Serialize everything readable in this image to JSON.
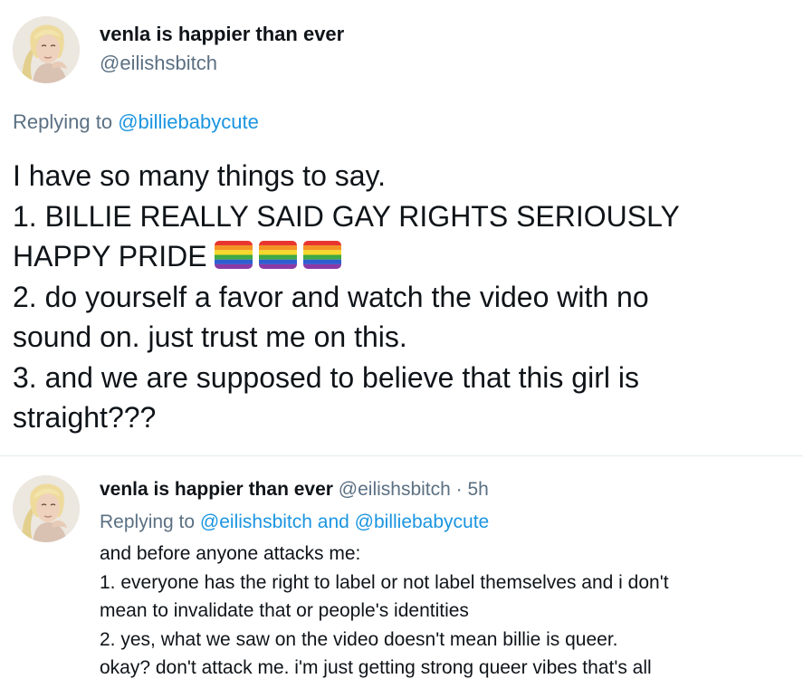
{
  "main_tweet": {
    "display_name": "venla is happier than ever",
    "handle": "@eilishsbitch",
    "replying_prefix": "Replying to ",
    "replying_to": "@billiebabycute",
    "body_lines": [
      "I have so many things to say.",
      "1. BILLIE REALLY SAID GAY RIGHTS SERIOUSLY",
      "HAPPY PRIDE",
      "2. do yourself a favor and watch the video with no",
      "sound on. just trust me on this.",
      "3. and we are supposed to believe that this girl is",
      "straight???"
    ],
    "emoji": [
      "rainbow-flag",
      "rainbow-flag",
      "rainbow-flag"
    ]
  },
  "reply_tweet": {
    "display_name": "venla is happier than ever",
    "handle": "@eilishsbitch",
    "separator": " · ",
    "time": "5h",
    "replying_prefix": "Replying to ",
    "replying_to_1": "@eilishsbitch",
    "replying_and": " and ",
    "replying_to_2": "@billiebabycute",
    "body_lines": [
      "and before anyone attacks me:",
      "1. everyone has the right to label or not label themselves and i don't",
      "mean to invalidate that or people's identities",
      "2. yes, what we saw on the video doesn't mean billie is queer.",
      "okay? don't attack me. i'm just getting strong queer vibes that's all"
    ]
  },
  "colors": {
    "text": "#0f1419",
    "secondary": "#5b7083",
    "link": "#1b95e0",
    "divider": "#e6ecf0"
  }
}
